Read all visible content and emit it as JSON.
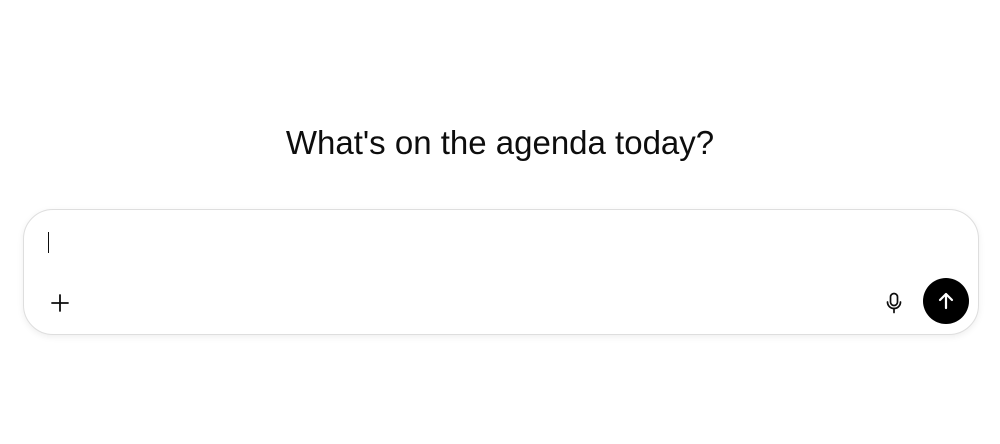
{
  "heading": "What's on the agenda today?",
  "composer": {
    "plus_icon": "plus-icon",
    "mic_icon": "microphone-icon",
    "send_icon": "arrow-up-icon",
    "send_color": "#000000"
  }
}
